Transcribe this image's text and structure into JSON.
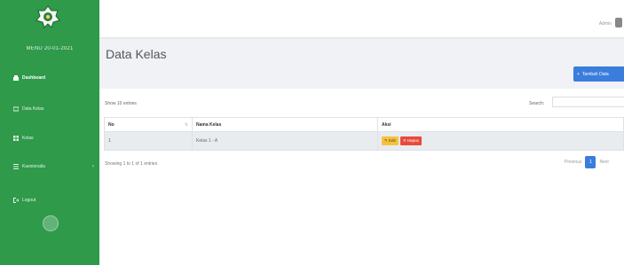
{
  "sidebar": {
    "brand": "MENU 20-01-2021",
    "items": [
      {
        "label": "Dashboard",
        "icon": "dashboard-icon",
        "active": true
      },
      {
        "label": "Data Kelas",
        "icon": "class-icon",
        "active": false
      },
      {
        "label": "Kelas",
        "icon": "grid-icon",
        "active": false
      },
      {
        "label": "Kuesionalia",
        "icon": "list-icon",
        "active": false,
        "has_submenu": true
      },
      {
        "label": "Logout",
        "icon": "logout-icon",
        "active": false
      }
    ],
    "toggle_icon": "sidebar-toggle-icon"
  },
  "topbar": {
    "user_name": "Admin",
    "user_icon": "user-icon"
  },
  "main": {
    "title": "Data Kelas",
    "add_button": "Tambah Data",
    "show_entries": "Show 10 entries",
    "search_label": "Search:",
    "search_value": "",
    "table": {
      "columns": [
        "No",
        "Nama Kelas",
        "Aksi"
      ],
      "rows": [
        {
          "no": "1",
          "nama_kelas": "Kelas 1 - A"
        }
      ],
      "edit_label": "Edit",
      "delete_label": "Hapus"
    },
    "showing": "Showing 1 to 1 of 1 entries",
    "pagination": {
      "previous": "Previous",
      "current": "1",
      "next": "Next"
    }
  },
  "colors": {
    "sidebar": "#2e9a4a",
    "primary": "#3b7ddd",
    "warning": "#f6c23e",
    "danger": "#e74a3b"
  }
}
